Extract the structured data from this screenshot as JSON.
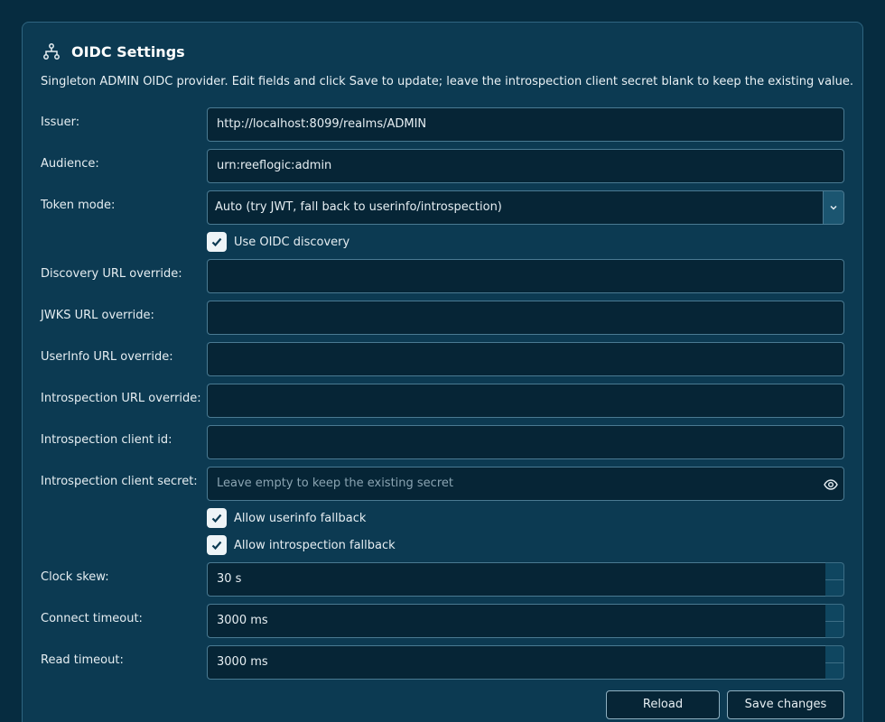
{
  "header": {
    "title": "OIDC Settings",
    "icon": "network-icon"
  },
  "description": "Singleton ADMIN OIDC provider. Edit fields and click Save to update; leave the introspection client secret blank to keep the existing value.",
  "fields": {
    "issuer": {
      "label": "Issuer:",
      "value": "http://localhost:8099/realms/ADMIN"
    },
    "audience": {
      "label": "Audience:",
      "value": "urn:reeflogic:admin"
    },
    "token_mode": {
      "label": "Token mode:",
      "value": "Auto (try JWT, fall back to userinfo/introspection)"
    },
    "discovery_url": {
      "label": "Discovery URL override:",
      "value": ""
    },
    "jwks_url": {
      "label": "JWKS URL override:",
      "value": ""
    },
    "userinfo_url": {
      "label": "UserInfo URL override:",
      "value": ""
    },
    "introspection_url": {
      "label": "Introspection URL override:",
      "value": ""
    },
    "introspection_client_id": {
      "label": "Introspection client id:",
      "value": ""
    },
    "introspection_client_secret": {
      "label": "Introspection client secret:",
      "value": "",
      "placeholder": "Leave empty to keep the existing secret"
    },
    "clock_skew": {
      "label": "Clock skew:",
      "value": "30 s"
    },
    "connect_timeout": {
      "label": "Connect timeout:",
      "value": "3000 ms"
    },
    "read_timeout": {
      "label": "Read timeout:",
      "value": "3000 ms"
    }
  },
  "checkboxes": {
    "use_discovery": {
      "label": "Use OIDC discovery",
      "checked": true
    },
    "allow_userinfo_fallback": {
      "label": "Allow userinfo fallback",
      "checked": true
    },
    "allow_introspection_fallback": {
      "label": "Allow introspection fallback",
      "checked": true
    }
  },
  "buttons": {
    "reload": "Reload",
    "save": "Save changes"
  }
}
